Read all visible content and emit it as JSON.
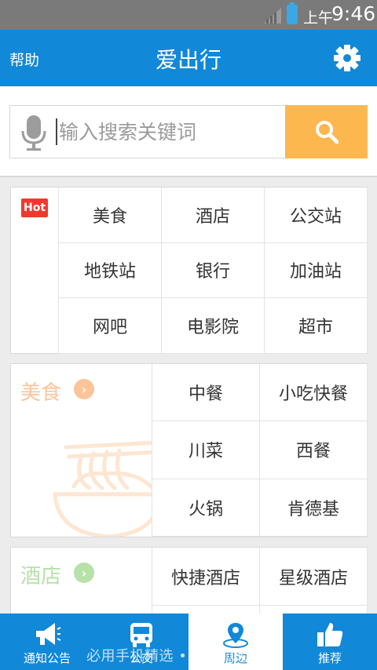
{
  "status_bar": {
    "ampm": "上午",
    "time": "9:46"
  },
  "header": {
    "help_label": "帮助",
    "title": "爱出行",
    "settings_icon": "gear-icon"
  },
  "search": {
    "placeholder": "输入搜索关键词",
    "value": "",
    "mic_icon": "microphone-icon",
    "button_icon": "search-icon",
    "button_color": "#fdb74f"
  },
  "hot": {
    "badge": "Hot",
    "items": [
      "美食",
      "酒店",
      "公交站",
      "地铁站",
      "银行",
      "加油站",
      "网吧",
      "电影院",
      "超市"
    ]
  },
  "categories": [
    {
      "title": "美食",
      "color": "#fdc49a",
      "items": [
        "中餐",
        "小吃快餐",
        "川菜",
        "西餐",
        "火锅",
        "肯德基"
      ]
    },
    {
      "title": "酒店",
      "color": "#b6e1a8",
      "items": [
        "快捷酒店",
        "星级酒店"
      ]
    }
  ],
  "tabs": [
    {
      "label": "通知公告",
      "icon": "megaphone-icon",
      "active": false
    },
    {
      "label": "公交",
      "icon": "bus-icon",
      "active": false
    },
    {
      "label": "周边",
      "icon": "location-pin-icon",
      "active": true
    },
    {
      "label": "推荐",
      "icon": "thumbs-up-icon",
      "active": false
    }
  ],
  "watermark": "必用手机精选 • BYJX.COM",
  "colors": {
    "primary": "#1188d8",
    "status_bar": "#7a7a7a",
    "hot_badge": "#ee3a2e"
  }
}
